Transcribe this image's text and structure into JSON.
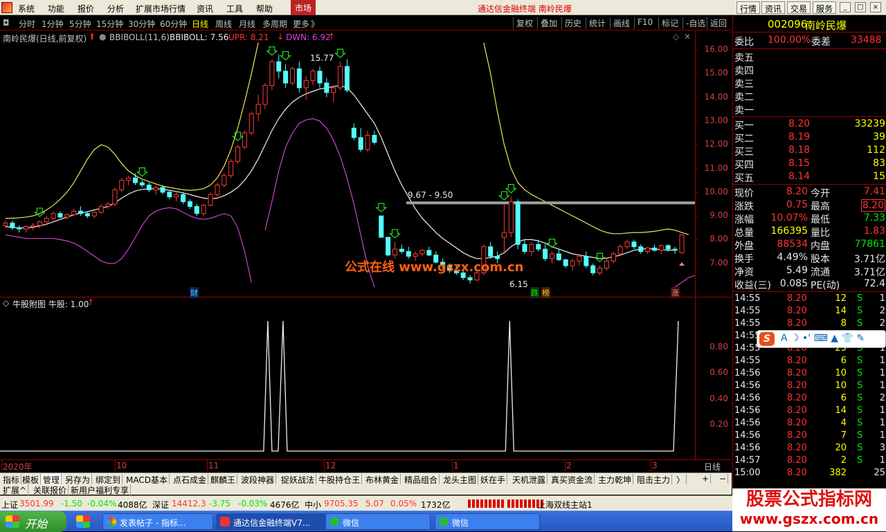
{
  "menubar": {
    "items": [
      "系统",
      "功能",
      "报价",
      "分析",
      "扩展市场行情",
      "资讯",
      "工具",
      "帮助"
    ],
    "market": "市场",
    "title": "通达信金融终端  南岭民爆",
    "right_buttons": [
      "行情",
      "资讯",
      "交易",
      "服务"
    ]
  },
  "periods": {
    "items": [
      "分时",
      "1分钟",
      "5分钟",
      "15分钟",
      "30分钟",
      "60分钟",
      "日线",
      "周线",
      "月线",
      "多周期",
      "更多"
    ],
    "active": "日线",
    "more_arrow": "》",
    "tools": [
      "复权",
      "叠加",
      "历史",
      "统计",
      "画线",
      "F10",
      "标记",
      "-自选",
      "返回"
    ]
  },
  "chart": {
    "header": {
      "name": "南岭民爆(日线,前复权)",
      "indicator": "BBIBOLL(11,6)",
      "bbiboll": "BBIBOLL: 7.56",
      "upr": "UPR: 8.21",
      "dwn": "DWN: 6.92"
    },
    "y_ticks": [
      "16.00",
      "15.00",
      "14.00",
      "13.00",
      "12.00",
      "11.00",
      "10.00",
      "9.00",
      "8.00",
      "7.00"
    ],
    "annotations": {
      "high": "15.77",
      "low": "6.15",
      "range": "9.67 - 9.50",
      "cai": "财",
      "die": "跌",
      "bang": "榜",
      "zhang": "涨"
    },
    "watermark": "公式在线 www.gszx.com.cn",
    "x_labels": [
      "2020年",
      "10",
      "11",
      "12",
      "1",
      "2",
      "3"
    ],
    "period_label": "日线"
  },
  "sub": {
    "header": "牛股附图 牛股: 1.00",
    "y_ticks": [
      "0.80",
      "0.60",
      "0.40",
      "0.20"
    ]
  },
  "chart_data": {
    "type": "candlestick",
    "ylim": [
      6.0,
      16.4
    ],
    "candles": [
      [
        8.6,
        8.8,
        8.5,
        8.7
      ],
      [
        8.7,
        8.8,
        8.4,
        8.5
      ],
      [
        8.5,
        8.6,
        8.3,
        8.45
      ],
      [
        8.45,
        8.6,
        8.3,
        8.55
      ],
      [
        8.55,
        8.7,
        8.4,
        8.6
      ],
      [
        8.6,
        8.8,
        8.5,
        8.75
      ],
      [
        8.75,
        9.0,
        8.6,
        8.9
      ],
      [
        8.9,
        9.2,
        8.8,
        9.1
      ],
      [
        9.1,
        9.2,
        8.9,
        8.95
      ],
      [
        8.95,
        9.1,
        8.85,
        9.05
      ],
      [
        9.05,
        9.3,
        9.0,
        9.2
      ],
      [
        9.2,
        9.4,
        9.0,
        9.1
      ],
      [
        9.1,
        9.2,
        8.9,
        9.0
      ],
      [
        9.0,
        9.2,
        8.9,
        9.15
      ],
      [
        9.15,
        9.5,
        9.1,
        9.4
      ],
      [
        9.4,
        9.6,
        9.3,
        9.5
      ],
      [
        9.5,
        10.2,
        9.4,
        10.1
      ],
      [
        10.1,
        10.6,
        10.0,
        10.5
      ],
      [
        10.5,
        10.7,
        10.3,
        10.6
      ],
      [
        10.6,
        10.8,
        10.3,
        10.4
      ],
      [
        10.4,
        10.5,
        10.2,
        10.3
      ],
      [
        10.3,
        10.4,
        10.0,
        10.1
      ],
      [
        10.1,
        10.3,
        9.9,
        10.2
      ],
      [
        10.2,
        10.3,
        9.9,
        10.0
      ],
      [
        10.0,
        10.1,
        9.7,
        9.8
      ],
      [
        9.8,
        10.0,
        9.6,
        9.9
      ],
      [
        9.9,
        10.0,
        9.5,
        9.6
      ],
      [
        9.6,
        9.7,
        9.3,
        9.4
      ],
      [
        9.4,
        9.5,
        9.0,
        9.1
      ],
      [
        9.1,
        9.5,
        9.0,
        9.45
      ],
      [
        9.45,
        10.0,
        9.4,
        9.9
      ],
      [
        9.9,
        10.4,
        9.8,
        10.3
      ],
      [
        10.3,
        10.8,
        10.2,
        10.7
      ],
      [
        10.7,
        11.4,
        10.6,
        11.3
      ],
      [
        11.3,
        12.0,
        11.2,
        11.9
      ],
      [
        11.9,
        12.6,
        11.8,
        12.5
      ],
      [
        12.5,
        13.4,
        12.4,
        13.3
      ],
      [
        13.3,
        14.1,
        13.0,
        13.7
      ],
      [
        13.7,
        14.6,
        13.5,
        14.5
      ],
      [
        14.5,
        15.6,
        14.3,
        15.5
      ],
      [
        15.5,
        15.8,
        14.8,
        15.1
      ],
      [
        15.1,
        15.4,
        14.4,
        14.6
      ],
      [
        14.6,
        15.3,
        14.5,
        15.2
      ],
      [
        15.2,
        15.5,
        14.2,
        14.4
      ],
      [
        14.4,
        14.9,
        13.9,
        14.7
      ],
      [
        14.7,
        15.2,
        14.5,
        15.1
      ],
      [
        15.1,
        15.3,
        14.4,
        14.6
      ],
      [
        14.6,
        14.8,
        14.0,
        14.2
      ],
      [
        14.2,
        14.5,
        13.8,
        14.4
      ],
      [
        14.4,
        15.5,
        14.3,
        15.3
      ],
      [
        15.3,
        15.6,
        14.2,
        14.3
      ],
      [
        12.7,
        12.9,
        12.2,
        12.3
      ],
      [
        12.3,
        12.7,
        11.7,
        11.8
      ],
      [
        11.8,
        12.6,
        11.7,
        12.4
      ],
      [
        12.4,
        12.6,
        12.0,
        12.1
      ],
      [
        9.0,
        9.0,
        8.1,
        8.1
      ],
      [
        8.1,
        8.1,
        7.3,
        7.35
      ],
      [
        7.35,
        7.9,
        7.2,
        7.6
      ],
      [
        7.6,
        7.8,
        7.4,
        7.5
      ],
      [
        7.5,
        7.7,
        7.2,
        7.3
      ],
      [
        7.3,
        7.5,
        7.1,
        7.4
      ],
      [
        7.4,
        7.6,
        7.3,
        7.55
      ],
      [
        7.55,
        7.7,
        7.3,
        7.35
      ],
      [
        7.35,
        7.5,
        7.0,
        7.05
      ],
      [
        7.05,
        7.2,
        6.8,
        6.9
      ],
      [
        6.9,
        7.0,
        6.6,
        6.7
      ],
      [
        6.7,
        6.9,
        6.5,
        6.6
      ],
      [
        6.6,
        6.7,
        6.3,
        6.4
      ],
      [
        6.4,
        6.5,
        6.15,
        6.3
      ],
      [
        6.3,
        6.7,
        6.25,
        6.6
      ],
      [
        6.6,
        7.8,
        6.5,
        7.7
      ],
      [
        7.7,
        7.9,
        7.2,
        7.3
      ],
      [
        7.3,
        7.5,
        7.0,
        7.2
      ],
      [
        8.1,
        9.5,
        7.4,
        8.3
      ],
      [
        8.3,
        9.8,
        8.1,
        9.6
      ],
      [
        9.6,
        9.7,
        7.6,
        7.8
      ],
      [
        7.8,
        8.0,
        7.4,
        7.5
      ],
      [
        7.5,
        7.9,
        7.3,
        7.8
      ],
      [
        7.8,
        8.0,
        7.5,
        7.6
      ],
      [
        7.6,
        7.8,
        7.1,
        7.2
      ],
      [
        7.2,
        7.5,
        7.0,
        7.4
      ],
      [
        7.4,
        7.6,
        7.1,
        7.15
      ],
      [
        7.15,
        7.2,
        6.8,
        6.9
      ],
      [
        6.9,
        7.2,
        6.7,
        7.1
      ],
      [
        7.1,
        7.4,
        6.9,
        7.3
      ],
      [
        7.3,
        7.5,
        6.8,
        6.9
      ],
      [
        6.9,
        7.0,
        6.5,
        6.6
      ],
      [
        6.6,
        6.9,
        6.5,
        6.8
      ],
      [
        6.8,
        7.2,
        6.7,
        7.1
      ],
      [
        7.1,
        7.5,
        7.0,
        7.4
      ],
      [
        7.4,
        7.8,
        7.3,
        7.7
      ],
      [
        7.7,
        8.0,
        7.6,
        7.9
      ],
      [
        7.9,
        8.0,
        7.6,
        7.7
      ],
      [
        7.7,
        7.8,
        7.4,
        7.5
      ],
      [
        7.5,
        7.7,
        7.4,
        7.65
      ],
      [
        7.65,
        7.8,
        7.5,
        7.55
      ],
      [
        7.55,
        7.8,
        7.4,
        7.75
      ],
      [
        7.75,
        7.8,
        7.5,
        7.6
      ],
      [
        7.6,
        7.7,
        7.4,
        7.55
      ],
      [
        7.45,
        8.2,
        7.41,
        8.2
      ]
    ],
    "series": {
      "bbi": [
        8.55,
        8.52,
        8.5,
        8.5,
        8.52,
        8.58,
        8.65,
        8.75,
        8.85,
        8.95,
        9.05,
        9.12,
        9.18,
        9.25,
        9.32,
        9.4,
        9.55,
        9.75,
        9.92,
        10.05,
        10.12,
        10.15,
        10.15,
        10.12,
        10.08,
        10.03,
        9.97,
        9.9,
        9.82,
        9.75,
        9.72,
        9.75,
        9.85,
        10.0,
        10.2,
        10.5,
        10.9,
        11.4,
        12.0,
        12.6,
        13.1,
        13.5,
        13.8,
        14.0,
        14.15,
        14.25,
        14.35,
        14.4,
        14.45,
        14.5,
        14.4,
        14.1,
        13.7,
        13.3,
        12.9,
        12.3,
        11.6,
        10.9,
        10.3,
        9.8,
        9.3,
        8.9,
        8.6,
        8.3,
        8.05,
        7.85,
        7.65,
        7.45,
        7.3,
        7.2,
        7.2,
        7.25,
        7.3,
        7.45,
        7.7,
        7.9,
        8.0,
        8.0,
        7.95,
        7.85,
        7.7,
        7.6,
        7.5,
        7.4,
        7.35,
        7.3,
        7.25,
        7.2,
        7.22,
        7.28,
        7.35,
        7.45,
        7.55,
        7.6,
        7.62,
        7.6,
        7.58,
        7.55,
        7.56
      ],
      "upr": [
        8.9,
        8.9,
        8.92,
        8.95,
        9.0,
        9.1,
        9.25,
        9.45,
        9.7,
        10.0,
        10.4,
        10.9,
        11.4,
        11.8,
        12.0,
        11.9,
        11.6,
        11.2,
        10.9,
        10.7,
        10.55,
        10.45,
        10.35,
        10.25,
        10.2,
        10.15,
        10.1,
        10.08,
        10.1,
        10.15,
        10.3,
        10.6,
        11.1,
        11.8,
        12.7,
        13.8,
        15.0,
        16.3,
        null,
        null,
        null,
        null,
        null,
        null,
        null,
        null,
        null,
        null,
        null,
        null,
        null,
        null,
        null,
        null,
        null,
        null,
        null,
        null,
        null,
        null,
        null,
        null,
        null,
        null,
        null,
        null,
        null,
        null,
        null,
        null,
        16.3,
        15.0,
        13.4,
        12.0,
        11.0,
        10.4,
        10.1,
        9.9,
        9.75,
        9.6,
        9.45,
        9.3,
        9.15,
        9.0,
        8.85,
        8.7,
        8.55,
        8.4,
        8.3,
        8.25,
        8.25,
        8.28,
        8.3,
        8.3,
        8.32,
        8.35,
        8.4,
        8.45,
        8.4,
        8.3,
        8.21
      ],
      "dwn": [
        8.2,
        8.15,
        8.1,
        8.05,
        8.05,
        8.05,
        8.05,
        8.05,
        8.0,
        7.95,
        7.85,
        7.7,
        7.5,
        7.3,
        7.1,
        7.0,
        7.0,
        7.2,
        7.6,
        8.1,
        8.6,
        9.0,
        9.2,
        9.3,
        9.35,
        9.3,
        9.15,
        9.0,
        8.9,
        8.85,
        8.9,
        9.0,
        9.1,
        9.0,
        8.5,
        7.5,
        6.2,
        null,
        null,
        null,
        null,
        null,
        null,
        null,
        null,
        null,
        null,
        null,
        null,
        null,
        null,
        null,
        null,
        null,
        null,
        null,
        null,
        null,
        null,
        null,
        null,
        null,
        null,
        null,
        null,
        null,
        null,
        null,
        null,
        null,
        null,
        null,
        null,
        null,
        null,
        null,
        null,
        null,
        null,
        null,
        null,
        null,
        null,
        null,
        null,
        null,
        null,
        null,
        null,
        null,
        null,
        null,
        null,
        null,
        null,
        null,
        null,
        null,
        6.0,
        6.2,
        6.4,
        6.5,
        6.6,
        6.65,
        6.75,
        6.92
      ],
      "dwn_top": [
        null,
        null,
        null,
        null,
        null,
        null,
        null,
        null,
        null,
        null,
        null,
        null,
        null,
        null,
        null,
        null,
        null,
        null,
        null,
        null,
        null,
        null,
        null,
        null,
        null,
        null,
        null,
        null,
        null,
        null,
        null,
        null,
        null,
        null,
        null,
        null,
        null,
        null,
        8.4,
        9.6,
        10.9,
        11.9,
        12.5,
        12.9,
        13.05,
        13.1,
        13.0,
        12.7,
        12.2,
        11.5,
        10.6,
        9.5,
        8.2,
        6.9,
        6.0
      ]
    },
    "signal_days": [
      39,
      41,
      74,
      99
    ]
  },
  "right": {
    "code": "002096",
    "name": "南岭民爆",
    "weibi_label": "委比",
    "weibi": "100.00%",
    "weicha_label": "委差",
    "weicha": "33488",
    "sells": [
      "卖五",
      "卖四",
      "卖三",
      "卖二",
      "卖一"
    ],
    "buys": [
      {
        "l": "买一",
        "p": "8.20",
        "v": "33239"
      },
      {
        "l": "买二",
        "p": "8.19",
        "v": "39"
      },
      {
        "l": "买三",
        "p": "8.18",
        "v": "112"
      },
      {
        "l": "买四",
        "p": "8.15",
        "v": "83"
      },
      {
        "l": "买五",
        "p": "8.14",
        "v": "15"
      }
    ],
    "stats": [
      {
        "l1": "现价",
        "v1": "8.20",
        "l2": "今开",
        "v2": "7.41"
      },
      {
        "l1": "涨跌",
        "v1": "0.75",
        "l2": "最高",
        "v2": "8.20"
      },
      {
        "l1": "涨幅",
        "v1": "10.07%",
        "l2": "最低",
        "v2": "7.33"
      },
      {
        "l1": "总量",
        "v1": "166395",
        "l2": "量比",
        "v2": "1.83"
      },
      {
        "l1": "外盘",
        "v1": "88534",
        "l2": "内盘",
        "v2": "77861"
      },
      {
        "l1": "换手",
        "v1": "4.49%",
        "l2": "股本",
        "v2": "3.71亿"
      },
      {
        "l1": "净资",
        "v1": "5.49",
        "l2": "流通",
        "v2": "3.71亿"
      },
      {
        "l1": "收益(三)",
        "v1": "0.085",
        "l2": "PE(动)",
        "v2": "72.4"
      }
    ],
    "ticks": [
      {
        "t": "14:55",
        "p": "8.20",
        "v": "12",
        "s": "S",
        "n": "1"
      },
      {
        "t": "14:55",
        "p": "8.20",
        "v": "14",
        "s": "S",
        "n": "2"
      },
      {
        "t": "14:55",
        "p": "8.20",
        "v": "8",
        "s": "S",
        "n": "2"
      },
      {
        "t": "14:55",
        "p": "8.20",
        "v": "10",
        "s": "S",
        "n": "1"
      },
      {
        "t": "14:55",
        "p": "8.20",
        "v": "25",
        "s": "S",
        "n": "1"
      },
      {
        "t": "14:55",
        "p": "8.20",
        "v": "6",
        "s": "S",
        "n": "1"
      },
      {
        "t": "14:56",
        "p": "8.20",
        "v": "10",
        "s": "S",
        "n": "1"
      },
      {
        "t": "14:56",
        "p": "8.20",
        "v": "10",
        "s": "S",
        "n": "1"
      },
      {
        "t": "14:56",
        "p": "8.20",
        "v": "6",
        "s": "S",
        "n": "2"
      },
      {
        "t": "14:56",
        "p": "8.20",
        "v": "14",
        "s": "S",
        "n": "1"
      },
      {
        "t": "14:56",
        "p": "8.20",
        "v": "4",
        "s": "S",
        "n": "1"
      },
      {
        "t": "14:56",
        "p": "8.20",
        "v": "7",
        "s": "S",
        "n": "1"
      },
      {
        "t": "14:56",
        "p": "8.20",
        "v": "20",
        "s": "S",
        "n": "3"
      },
      {
        "t": "14:57",
        "p": "8.20",
        "v": "2",
        "s": "S",
        "n": "1"
      },
      {
        "t": "15:00",
        "p": "8.20",
        "v": "382",
        "s": "",
        "n": "25"
      }
    ]
  },
  "bottom_tabs": [
    "指标",
    "模板",
    "管理",
    "另存为",
    "绑定到",
    "MACD基本",
    "点石成金",
    "麒麟王",
    "波段神器",
    "捉妖战法",
    "牛股持仓王",
    "布林黄金",
    "精品组合",
    "龙头主图",
    "妖在手",
    "天机泄露",
    "真买资金流",
    "主力乾坤",
    "阻击主力"
  ],
  "bottom_active": "管理",
  "nav_arrow": "〉",
  "zoom_in": "+",
  "zoom_out": "−",
  "extra_tabs": [
    "扩展^",
    "关联报价",
    "新用户福利专享"
  ],
  "status": {
    "sh_l": "上证",
    "sh_v": "3501.99",
    "sh_c": "-1.50",
    "sh_p": "-0.04%",
    "sh_a": "4088亿",
    "sz_l": "深证",
    "sz_v": "14412.3",
    "sz_c": "-3.75",
    "sz_p": "-0.03%",
    "sz_a": "4676亿",
    "zx_l": "中小",
    "zx_v": "9705.35",
    "zx_c": "5.07",
    "zx_p": "0.05%",
    "zx_a": "1732亿",
    "server": "上海双线主站1"
  },
  "taskbar": {
    "start": "开始",
    "items": [
      "发表帖子 - 指标...",
      "通达信金融终端V7...",
      "微信",
      "微信"
    ]
  },
  "ime": {
    "logo": "S",
    "text": "A ☽ •' ⌨ ▲ 👕 ✎"
  },
  "site_watermark": {
    "title": "股票公式指标网",
    "url": "www.gszx.com.cn"
  }
}
